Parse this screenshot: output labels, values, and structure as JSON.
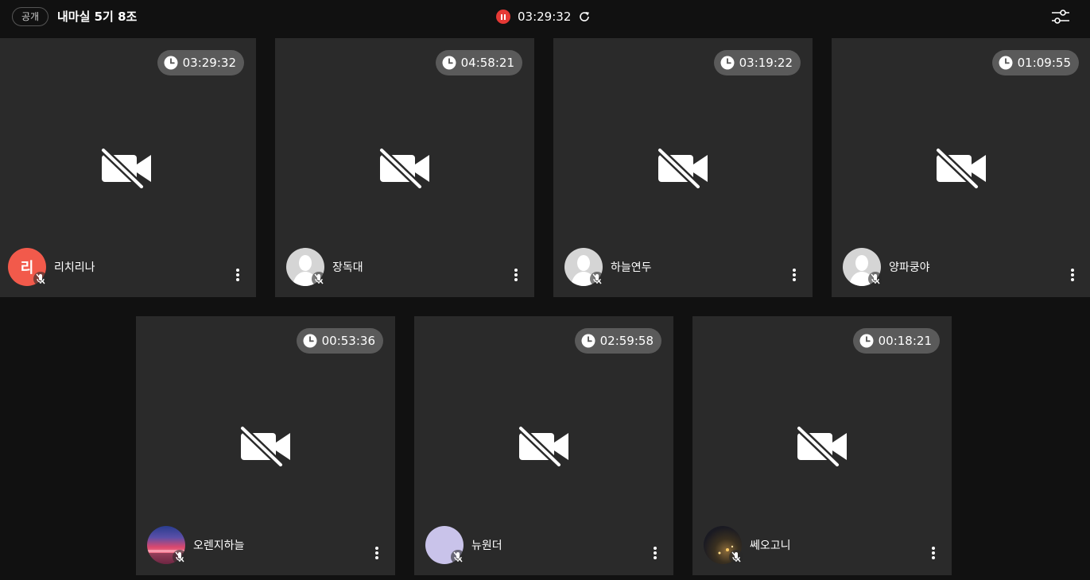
{
  "header": {
    "visibility_badge": "공개",
    "room_title": "내마실 5기 8조",
    "session_timer": "03:29:32"
  },
  "colors": {
    "background": "#111111",
    "tile": "#2a2a2a",
    "pause_red": "#e53935",
    "timer_pill": "#5a5a5a"
  },
  "participants": [
    {
      "name": "리치리나",
      "time": "03:29:32",
      "avatar_letter": "리",
      "avatar_color": "#f25a4b",
      "avatar_type": "letter",
      "mic": "muted",
      "camera": "off"
    },
    {
      "name": "장독대",
      "time": "04:58:21",
      "avatar_type": "default",
      "mic": "muted",
      "camera": "off"
    },
    {
      "name": "하늘연두",
      "time": "03:19:22",
      "avatar_type": "default",
      "mic": "muted",
      "camera": "off"
    },
    {
      "name": "양파쿵야",
      "time": "01:09:55",
      "avatar_type": "default",
      "mic": "muted",
      "camera": "off"
    },
    {
      "name": "오렌지하늘",
      "time": "00:53:36",
      "avatar_type": "photo-sunset",
      "mic": "muted",
      "camera": "off"
    },
    {
      "name": "뉴원더",
      "time": "02:59:58",
      "avatar_type": "solid",
      "avatar_color": "#c9c3ea",
      "mic": "muted",
      "camera": "off"
    },
    {
      "name": "쎄오고니",
      "time": "00:18:21",
      "avatar_type": "photo-night",
      "mic": "muted",
      "camera": "off"
    }
  ]
}
